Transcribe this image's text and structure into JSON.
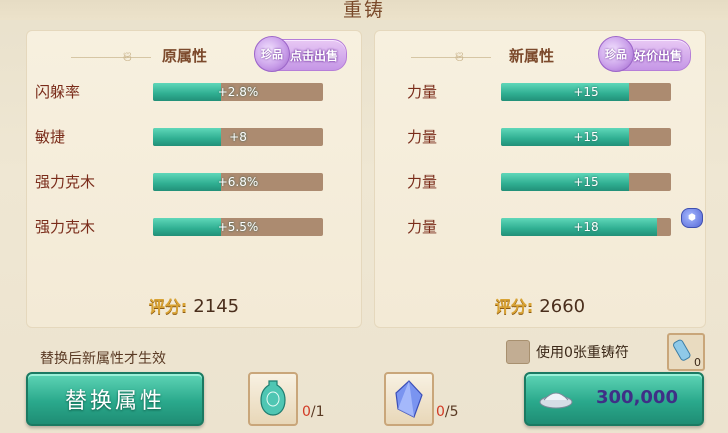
{
  "window": {
    "title": "重铸"
  },
  "left_panel": {
    "title": "原属性",
    "sell_label": "点击出售",
    "gem_label": "珍品",
    "stats": [
      {
        "label": "闪躲率",
        "value": "+2.8%",
        "fill": 0.4
      },
      {
        "label": "敏捷",
        "value": "+8",
        "fill": 0.4
      },
      {
        "label": "强力克木",
        "value": "+6.8%",
        "fill": 0.4
      },
      {
        "label": "强力克木",
        "value": "+5.5%",
        "fill": 0.4
      }
    ],
    "score_label": "评分:",
    "score": "2145"
  },
  "right_panel": {
    "title": "新属性",
    "sell_label": "好价出售",
    "gem_label": "珍品",
    "stats": [
      {
        "label": "力量",
        "value": "+15",
        "fill": 0.75
      },
      {
        "label": "力量",
        "value": "+15",
        "fill": 0.75
      },
      {
        "label": "力量",
        "value": "+15",
        "fill": 0.75
      },
      {
        "label": "力量",
        "value": "+18",
        "fill": 0.92
      }
    ],
    "score_label": "评分:",
    "score": "2660"
  },
  "hint": "替换后新属性才生效",
  "replace_button": "替换属性",
  "items": [
    {
      "name": "vase",
      "current": "0",
      "required": "/1"
    },
    {
      "name": "crystal",
      "current": "0",
      "required": "/5"
    }
  ],
  "use_scroll_label": "使用0张重铸符",
  "scroll_count": "0",
  "cost": "300,000",
  "colors": {
    "accent": "#2aa98c",
    "score_label": "#d9a334",
    "purple": "#c596e6"
  }
}
